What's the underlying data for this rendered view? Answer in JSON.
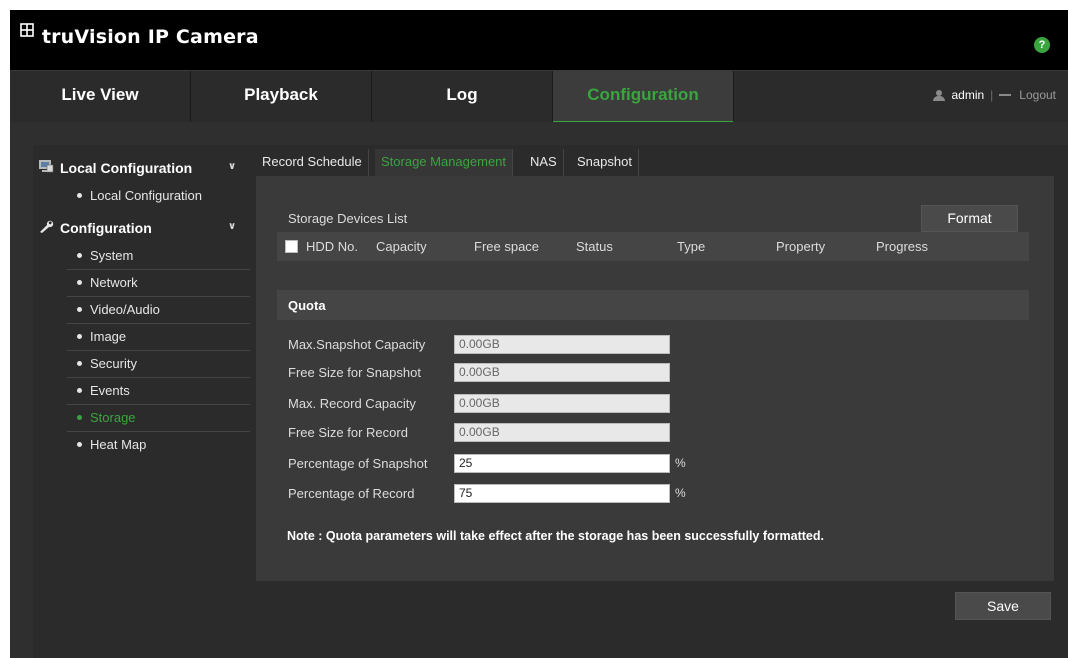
{
  "app": {
    "title": "truVision IP Camera",
    "help_label": "?"
  },
  "nav": {
    "tabs": [
      {
        "label": "Live View"
      },
      {
        "label": "Playback"
      },
      {
        "label": "Log"
      },
      {
        "label": "Configuration"
      }
    ],
    "active_tab": "Configuration",
    "user": "admin",
    "separator": "|",
    "logout": "Logout"
  },
  "sidebar": {
    "groups": [
      {
        "label": "Local Configuration",
        "icon": "monitor-icon",
        "items": [
          {
            "label": "Local Configuration"
          }
        ]
      },
      {
        "label": "Configuration",
        "icon": "wrench-icon",
        "items": [
          {
            "label": "System"
          },
          {
            "label": "Network"
          },
          {
            "label": "Video/Audio"
          },
          {
            "label": "Image"
          },
          {
            "label": "Security"
          },
          {
            "label": "Events"
          },
          {
            "label": "Storage"
          },
          {
            "label": "Heat Map"
          }
        ]
      }
    ],
    "active_item": "Storage"
  },
  "tabs": [
    {
      "label": "Record Schedule"
    },
    {
      "label": "Storage Management"
    },
    {
      "label": "NAS"
    },
    {
      "label": "Snapshot"
    }
  ],
  "active_tab": "Storage Management",
  "storage": {
    "list_title": "Storage Devices List",
    "format_label": "Format",
    "columns": [
      "HDD No.",
      "Capacity",
      "Free space",
      "Status",
      "Type",
      "Property",
      "Progress"
    ]
  },
  "quota": {
    "title": "Quota",
    "fields": [
      {
        "label": "Max.Snapshot Capacity",
        "value": "0.00GB",
        "unit": "",
        "editable": false
      },
      {
        "label": "Free Size for Snapshot",
        "value": "0.00GB",
        "unit": "",
        "editable": false
      },
      {
        "label": "Max. Record Capacity",
        "value": "0.00GB",
        "unit": "",
        "editable": false
      },
      {
        "label": "Free Size for Record",
        "value": "0.00GB",
        "unit": "",
        "editable": false
      },
      {
        "label": "Percentage of Snapshot",
        "value": "25",
        "unit": "%",
        "editable": true
      },
      {
        "label": "Percentage of Record",
        "value": "75",
        "unit": "%",
        "editable": true
      }
    ],
    "note": "Note :  Quota parameters will take effect after the storage has been successfully formatted."
  },
  "save_label": "Save",
  "colors": {
    "accent": "#3aa53e",
    "header_bg": "#000000",
    "nav_bg": "#2b2b2b",
    "panel_bg": "#3a3a3a"
  }
}
